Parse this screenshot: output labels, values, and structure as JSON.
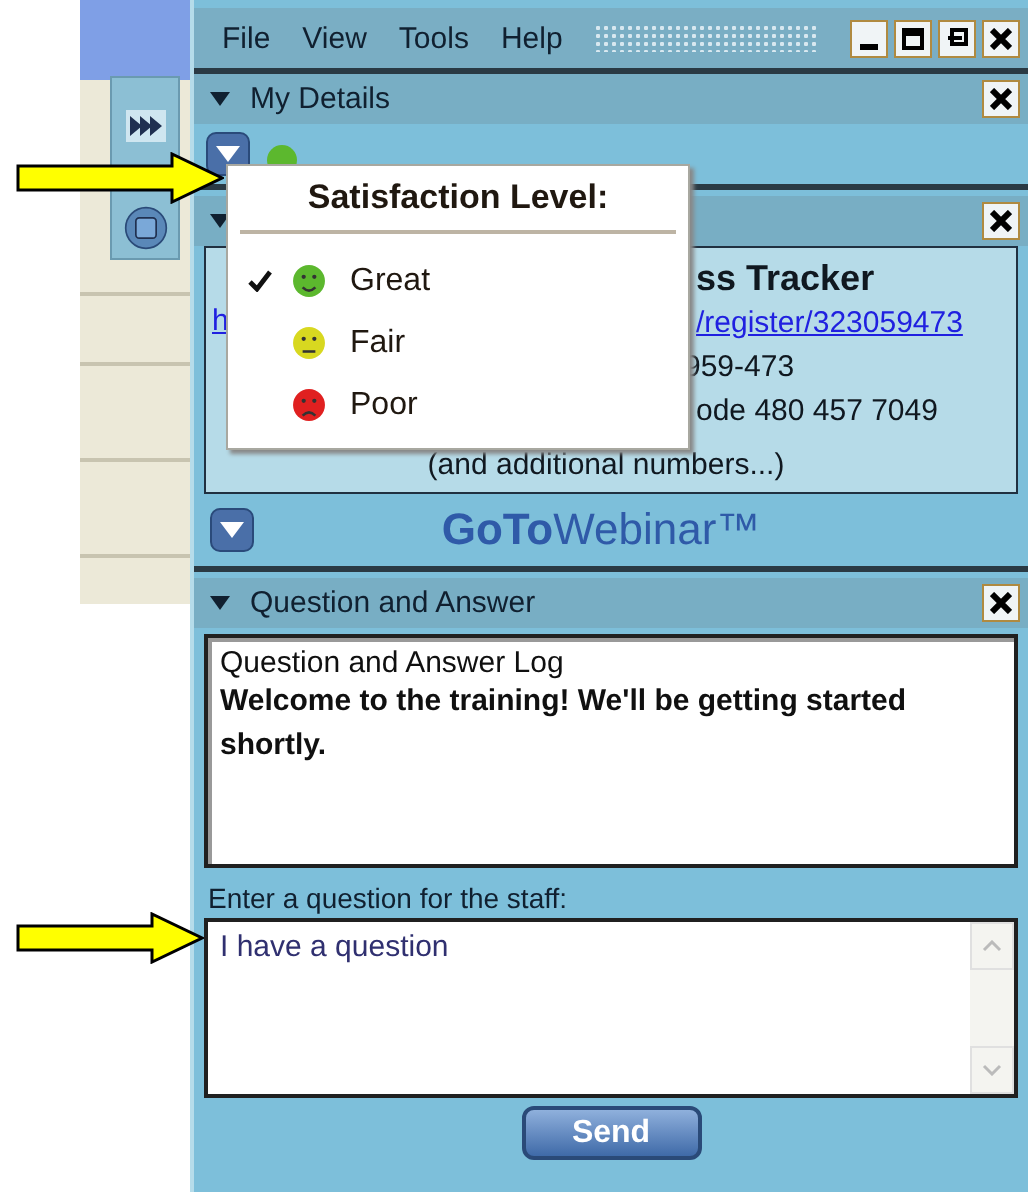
{
  "menu": [
    {
      "label": "File"
    },
    {
      "label": "View"
    },
    {
      "label": "Tools"
    },
    {
      "label": "Help"
    }
  ],
  "my_details": {
    "title": "My Details"
  },
  "satisfaction_menu": {
    "title": "Satisfaction Level:",
    "items": [
      {
        "label": "Great",
        "kind": "happy",
        "color": "#5cb82e",
        "selected": true
      },
      {
        "label": "Fair",
        "kind": "neutral",
        "color": "#d8d820",
        "selected": false
      },
      {
        "label": "Poor",
        "kind": "sad",
        "color": "#e02020",
        "selected": false
      }
    ]
  },
  "webinar": {
    "title_fragment": "ss Tracker",
    "link_start": "h",
    "link_end": "/register/323059473",
    "line_3": "959-473",
    "line_4": "ode 480 457 7049",
    "line_5": "(and additional numbers...)",
    "logo": "**GoTo**Webinar™"
  },
  "qa": {
    "title": "Question and Answer",
    "log_title": "Question and Answer Log",
    "log_message": "Welcome to the training! We'll be getting started shortly.",
    "prompt": "Enter a question for the staff:",
    "question": "I have a question",
    "send": "Send"
  }
}
